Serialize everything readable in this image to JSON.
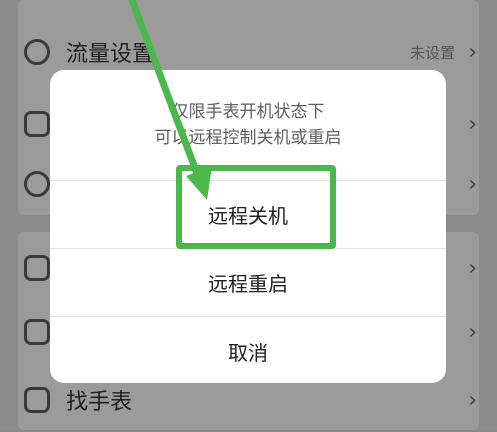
{
  "background": {
    "rows": [
      {
        "label": "流量设置",
        "value": "未设置"
      },
      {
        "label": "找手表",
        "value": ""
      }
    ]
  },
  "dialog": {
    "message_line1": "仅限手表开机状态下",
    "message_line2": "可以远程控制关机或重启",
    "option_shutdown": "远程关机",
    "option_restart": "远程重启",
    "option_cancel": "取消"
  },
  "colors": {
    "highlight": "#4bb84b",
    "dim_background": "#8c8c8c",
    "dialog_background": "#ffffff"
  }
}
